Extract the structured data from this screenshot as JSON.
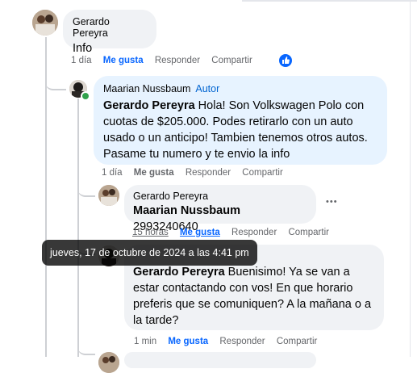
{
  "comments": [
    {
      "author": "Gerardo Pereyra",
      "text": "Info",
      "actions": {
        "time": "1 día",
        "like": "Me gusta",
        "reply": "Responder",
        "share": "Compartir"
      }
    },
    {
      "author": "Maarian Nussbaum",
      "badge": "Autor",
      "mention": "Gerardo Pereyra",
      "text": " Hola! Son Volkswagen Polo con cuotas de $205.000. Podes retirarlo con un auto usado o un anticipo! Tambien tenemos otros autos. Pasame tu numero y te envio la info",
      "actions": {
        "time": "1 día",
        "like": "Me gusta",
        "reply": "Responder",
        "share": "Compartir"
      }
    },
    {
      "author": "Gerardo Pereyra",
      "mention": "Maarian Nussbaum",
      "text": " 2993240640",
      "actions": {
        "time": "15 horas",
        "like": "Me gusta",
        "reply": "Responder",
        "share": "Compartir"
      }
    },
    {
      "mention": "Gerardo Pereyra",
      "text": " Buenisimo! Ya se van a estar contactando con vos! En que horario preferis que se comuniquen? A la mañana o a la tarde?",
      "actions": {
        "time": "1 min",
        "like": "Me gusta",
        "reply": "Responder",
        "share": "Compartir"
      }
    }
  ],
  "tooltip": "jueves, 17 de octubre de 2024 a las 4:41 pm",
  "more_label": "•••",
  "colors": {
    "accent": "#0866ff",
    "bubble": "#f0f2f5",
    "author_bubble": "#e7f3ff",
    "online": "#31a24c"
  }
}
